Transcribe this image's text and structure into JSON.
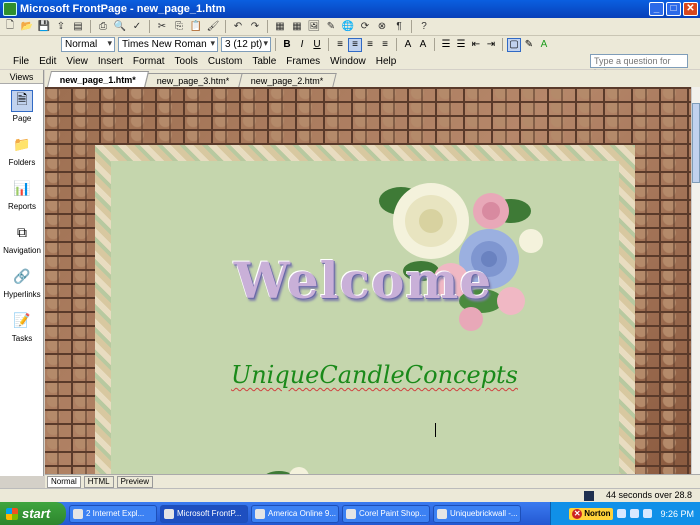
{
  "window": {
    "title": "Microsoft FrontPage - new_page_1.htm"
  },
  "format_toolbar": {
    "style": "Normal",
    "font": "Times New Roman",
    "size": "3  (12 pt)"
  },
  "menu": [
    "File",
    "Edit",
    "View",
    "Insert",
    "Format",
    "Tools",
    "Custom",
    "Table",
    "Frames",
    "Window",
    "Help"
  ],
  "help_placeholder": "Type a question for help",
  "views": {
    "header": "Views",
    "items": [
      "Page",
      "Folders",
      "Reports",
      "Navigation",
      "Hyperlinks",
      "Tasks"
    ]
  },
  "tabs": [
    "new_page_1.htm*",
    "new_page_3.htm*",
    "new_page_2.htm*"
  ],
  "page": {
    "welcome": "Welcome",
    "brand": "UniqueCandleConcepts"
  },
  "modes": [
    "Normal",
    "HTML",
    "Preview"
  ],
  "status": {
    "text": "44 seconds over 28.8"
  },
  "taskbar": {
    "start": "start",
    "buttons": [
      "2 Internet Expl...",
      "Microsoft FrontP...",
      "America Online 9...",
      "Corel Paint Shop...",
      "Uniquebrickwall -..."
    ],
    "norton": "Norton",
    "clock": "9:26 PM"
  },
  "colors": {
    "titlebar": "#0a5fe0",
    "canvas": "#c5d6ad",
    "brand_text": "#1a8a1a",
    "taskbar": "#2458d2"
  }
}
